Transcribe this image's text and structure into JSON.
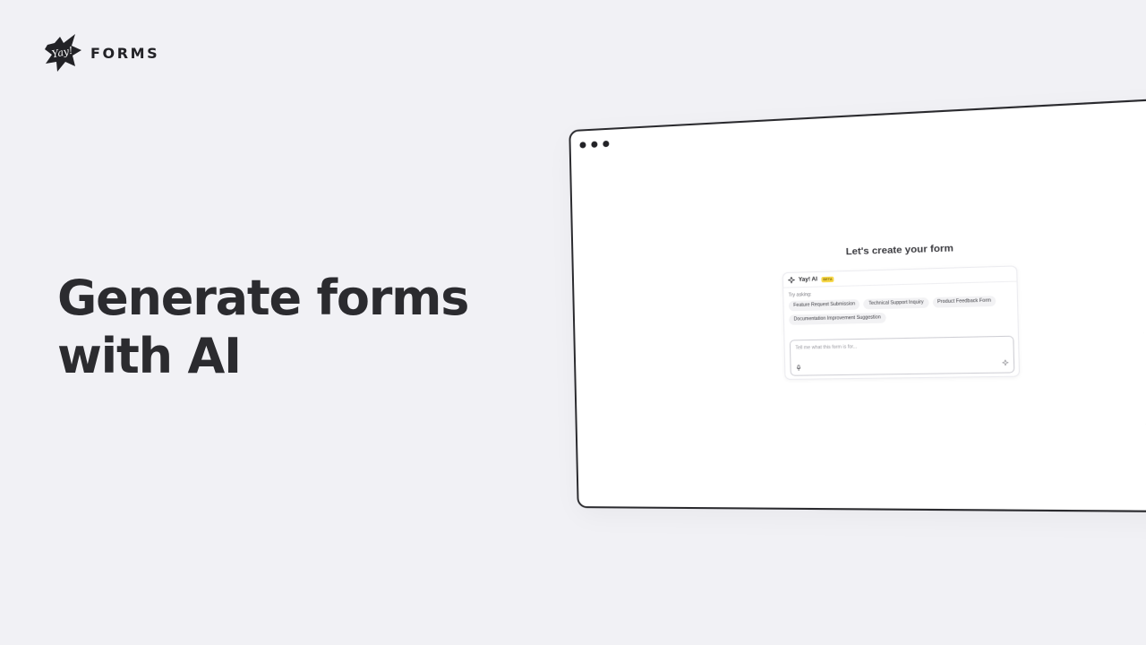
{
  "brand": {
    "logo_script": "Yay!",
    "name": "FORMS",
    "logo_icon": "yay-splash-logo-icon"
  },
  "hero": {
    "headline_line1": "Generate forms",
    "headline_line2": "with AI"
  },
  "mockup": {
    "window_controls": [
      "dot",
      "dot",
      "dot"
    ],
    "title": "Let's create your form",
    "ai_panel": {
      "icon": "sparkle-icon",
      "name": "Yay! AI",
      "badge": "BETA",
      "try_label": "Try asking:",
      "suggestions": [
        "Feature Request Submission",
        "Technical Support Inquiry",
        "Product Feedback Form",
        "Documentation Improvement Suggestion"
      ],
      "prompt_placeholder": "Tell me what this form is for...",
      "mic_icon": "microphone-icon",
      "send_icon": "sparkle-send-icon"
    }
  },
  "colors": {
    "background": "#f1f1f5",
    "text": "#2b2b2f",
    "badge": "#f7d84a",
    "window": "#ffffff"
  }
}
